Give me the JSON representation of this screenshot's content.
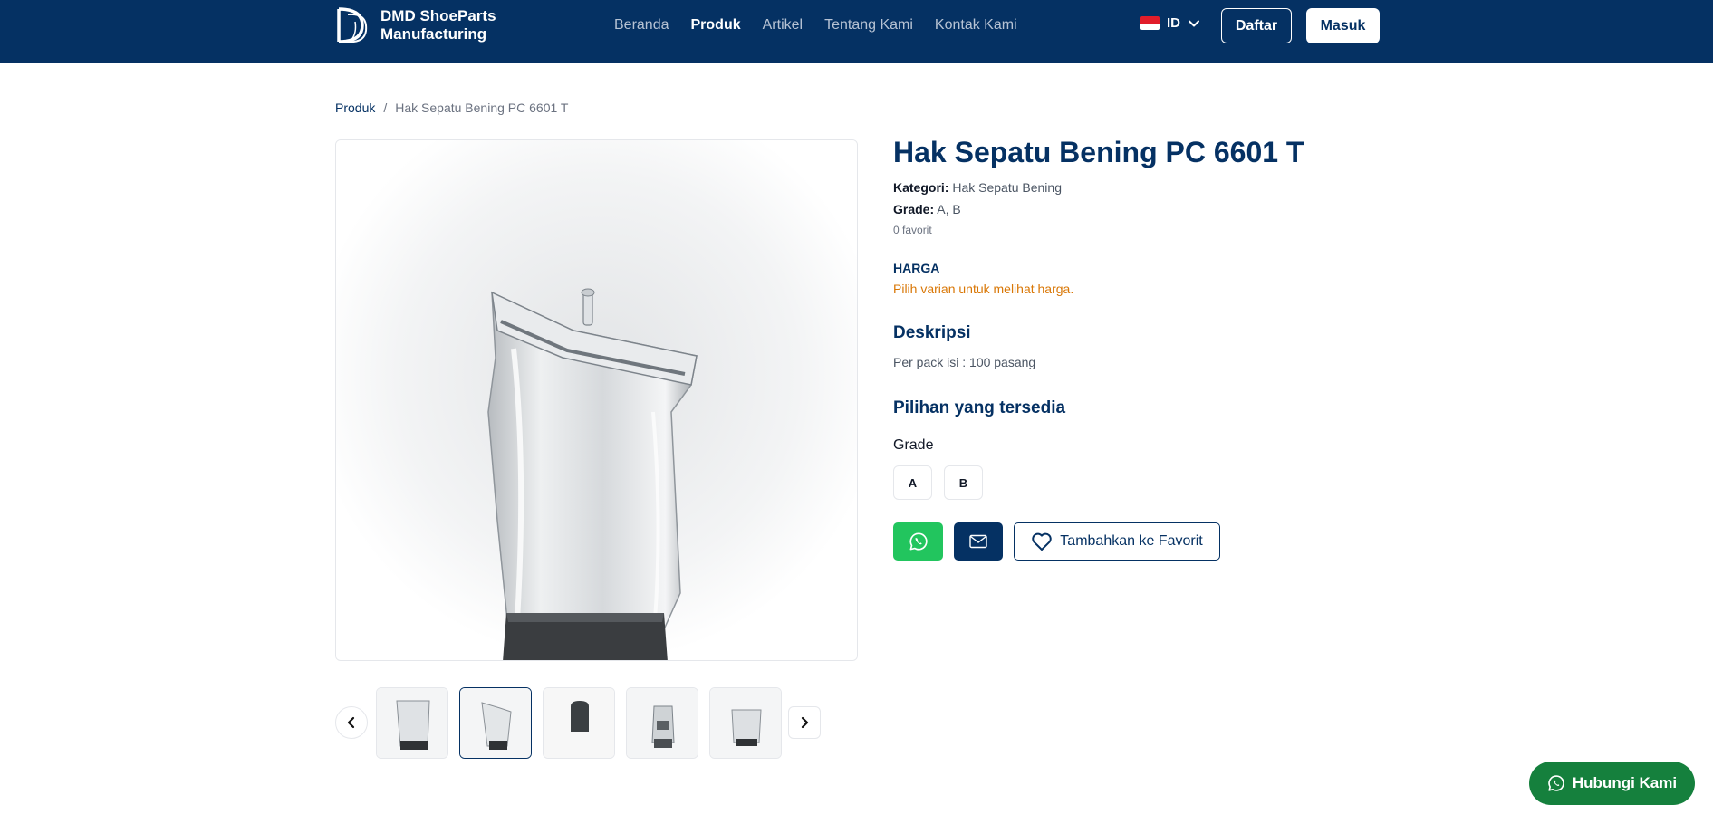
{
  "header": {
    "brand_line1": "DMD ShoeParts",
    "brand_line2": "Manufacturing",
    "nav": [
      {
        "label": "Beranda",
        "active": false
      },
      {
        "label": "Produk",
        "active": true
      },
      {
        "label": "Artikel",
        "active": false
      },
      {
        "label": "Tentang Kami",
        "active": false
      },
      {
        "label": "Kontak Kami",
        "active": false
      }
    ],
    "language": "ID",
    "register_label": "Daftar",
    "login_label": "Masuk"
  },
  "breadcrumb": {
    "parent": "Produk",
    "separator": "/",
    "current": "Hak Sepatu Bening PC 6601 T"
  },
  "product": {
    "title": "Hak Sepatu Bening PC 6601 T",
    "category_label": "Kategori:",
    "category_value": "Hak Sepatu Bening",
    "grade_label": "Grade:",
    "grade_value": "A, B",
    "favorites": "0 favorit",
    "price_label": "HARGA",
    "price_note": "Pilih varian untuk melihat harga.",
    "description_title": "Deskripsi",
    "description_text": "Per pack isi : 100 pasang",
    "options_title": "Pilihan yang tersedia",
    "option_group_label": "Grade",
    "option_values": [
      "A",
      "B"
    ],
    "favorite_button": "Tambahkan ke Favorit"
  },
  "gallery": {
    "thumbnail_count": 5,
    "active_thumbnail": 2
  },
  "floating": {
    "contact_label": "Hubungi Kami"
  },
  "colors": {
    "primary": "#053163",
    "whatsapp": "#22c55e",
    "contact": "#15803d",
    "price_note": "#d97706"
  }
}
